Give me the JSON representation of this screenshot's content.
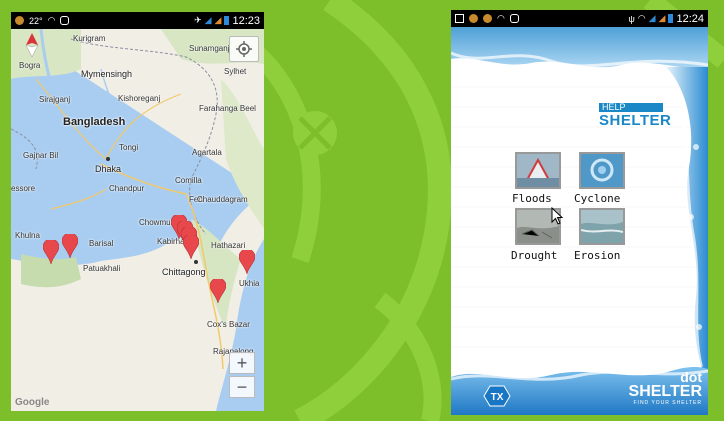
{
  "phone_map": {
    "status": {
      "temp": "22°",
      "time": "12:23"
    },
    "labels": {
      "kurigram": "Kurigram",
      "bogra": "Bogra",
      "mymensingh": "Mymensingh",
      "sunamganj": "Sunamganj",
      "sylhet": "Sylhet",
      "sirajganj": "Sirajganj",
      "kishoreganj": "Kishoreganj",
      "bangladesh": "Bangladesh",
      "farahanga": "Farahanga Beel",
      "gajnar": "Gajnar Bil",
      "tongi": "Tongi",
      "agartala": "Agartala",
      "dhaka": "Dhaka",
      "kalasessore": "essore",
      "chandpur": "Chandpur",
      "comilla": "Comilla",
      "feni": "Feni",
      "chauddagram": "Chauddagram",
      "khulna": "Khulna",
      "chowmuhani": "Chowmuhani",
      "barisal": "Barisal",
      "kabirhat": "Kabirhat",
      "hathazari": "Hathazari",
      "patuakhali": "Patuakhali",
      "chittagong": "Chittagong",
      "ukhia": "Ukhia",
      "coxs_bazar": "Cox's Bazar",
      "rajapalong": "Rajapalong"
    },
    "controls": {
      "zoom_in": "+",
      "zoom_out": "−",
      "google": "Google"
    }
  },
  "phone_shelter": {
    "status": {
      "time": "12:24"
    },
    "brand": {
      "help": "HELP",
      "shelter": "SHELTER"
    },
    "tiles": [
      {
        "label": "Floods"
      },
      {
        "label": "Cyclone"
      },
      {
        "label": "Drought"
      },
      {
        "label": "Erosion"
      }
    ],
    "footer": {
      "badge": "TX",
      "dot": "dot",
      "shelter": "SHELTER",
      "tagline": "FIND YOUR SHELTER"
    }
  },
  "colors": {
    "background": "#7cbf2a",
    "accent": "#1a88c7",
    "pin": "#e8474b"
  }
}
